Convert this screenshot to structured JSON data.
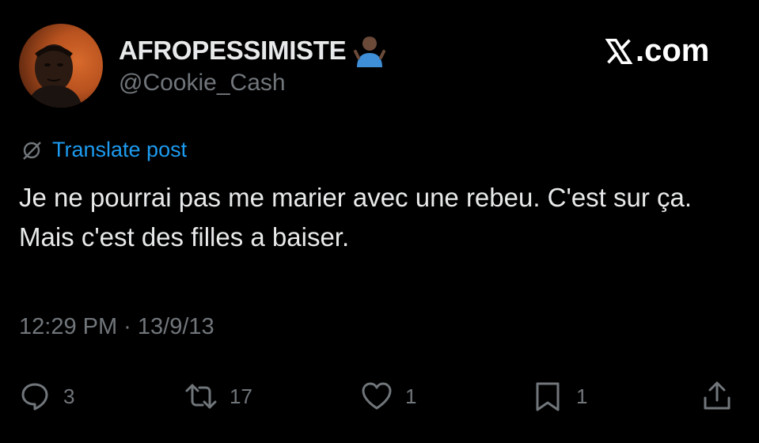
{
  "user": {
    "display_name": "AFROPESSIMISTE",
    "handle": "@Cookie_Cash",
    "name_emoji": "person-shrugging-emoji"
  },
  "brand": {
    "label": ".com",
    "logo": "x-logo"
  },
  "translate": {
    "label": "Translate post",
    "icon": "globe-icon"
  },
  "post": {
    "text": "Je ne pourrai pas me marier avec une rebeu. C'est sur ça. Mais c'est des filles a baiser.",
    "timestamp": "12:29 PM · 13/9/13"
  },
  "actions": {
    "reply": {
      "icon": "reply-icon",
      "count": "3"
    },
    "repost": {
      "icon": "repost-icon",
      "count": "17"
    },
    "like": {
      "icon": "heart-icon",
      "count": "1"
    },
    "bookmark": {
      "icon": "bookmark-icon",
      "count": "1"
    },
    "share": {
      "icon": "share-icon"
    }
  },
  "colors": {
    "background": "#000000",
    "text": "#e7e9ea",
    "muted": "#71767b",
    "link": "#1d9bf0"
  }
}
